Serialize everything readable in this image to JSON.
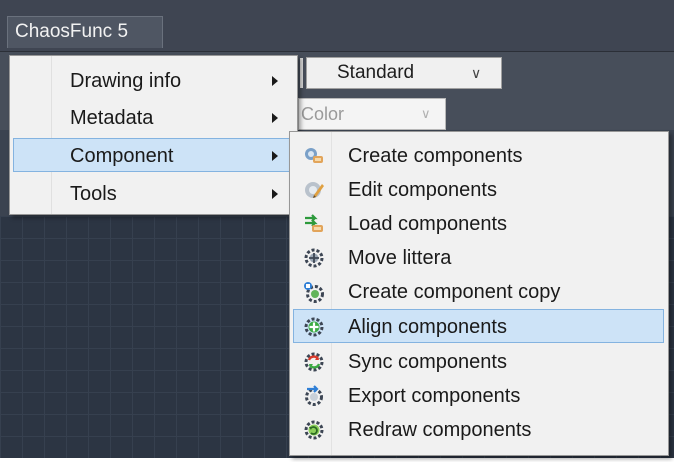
{
  "app": {
    "menu_title": "ChaosFunc 5"
  },
  "toolbar": {
    "standard_dropdown": "Standard",
    "color_dropdown": "Color"
  },
  "main_menu": {
    "items": [
      {
        "label": "Drawing info",
        "has_submenu": true,
        "highlighted": false
      },
      {
        "label": "Metadata",
        "has_submenu": true,
        "highlighted": false
      },
      {
        "label": "Component",
        "has_submenu": true,
        "highlighted": true
      },
      {
        "label": "Tools",
        "has_submenu": true,
        "highlighted": false
      }
    ]
  },
  "component_submenu": {
    "items": [
      {
        "label": "Create components",
        "icon": "create-components-icon",
        "highlighted": false
      },
      {
        "label": "Edit components",
        "icon": "edit-components-icon",
        "highlighted": false
      },
      {
        "label": "Load components",
        "icon": "load-components-icon",
        "highlighted": false
      },
      {
        "label": "Move littera",
        "icon": "move-littera-icon",
        "highlighted": false
      },
      {
        "label": "Create component copy",
        "icon": "component-copy-icon",
        "highlighted": false
      },
      {
        "label": "Align components",
        "icon": "align-components-icon",
        "highlighted": true
      },
      {
        "label": "Sync components",
        "icon": "sync-components-icon",
        "highlighted": false
      },
      {
        "label": "Export components",
        "icon": "export-components-icon",
        "highlighted": false
      },
      {
        "label": "Redraw components",
        "icon": "redraw-components-icon",
        "highlighted": false
      }
    ]
  },
  "colors": {
    "frame_background": "#3b4350",
    "menu_background": "#f1f1f1",
    "highlight_fill": "#cde3f7",
    "highlight_border": "#84b3e0"
  }
}
